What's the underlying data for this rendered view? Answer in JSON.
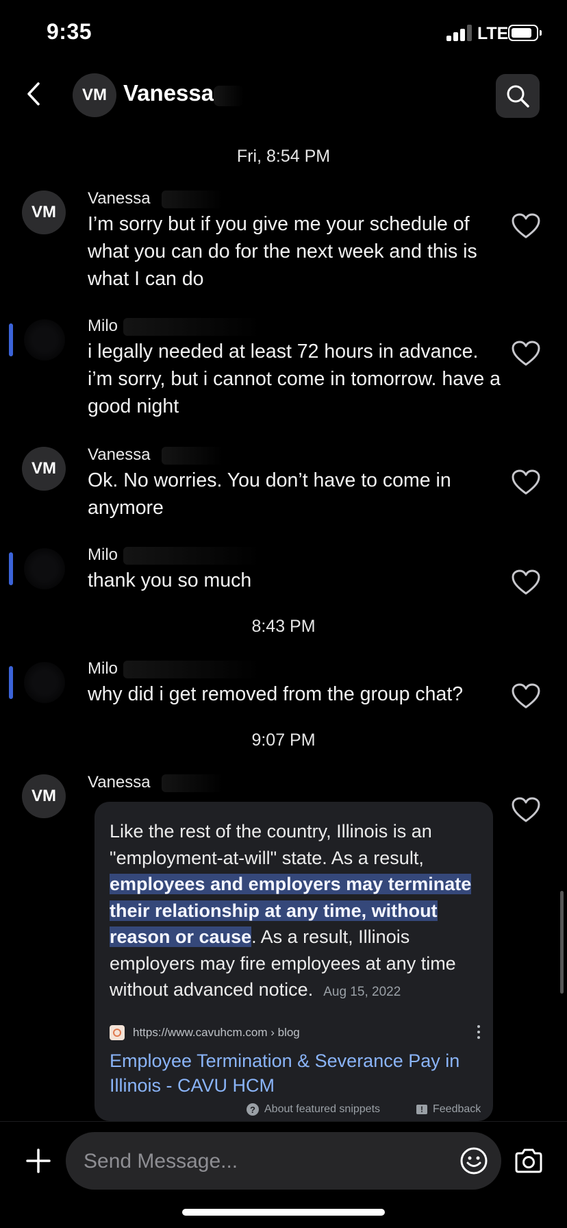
{
  "status_bar": {
    "time": "9:35",
    "network": "LTE"
  },
  "header": {
    "avatar_initials": "VM",
    "contact_name": "Vanessa"
  },
  "thread": {
    "timestamps": [
      "Fri, 8:54 PM",
      "8:43 PM",
      "9:07 PM"
    ],
    "messages": [
      {
        "sender": "Vanessa",
        "avatar": "VM",
        "text": "I’m sorry but if you give me your schedule of what you can do for the next week and this is what I can do"
      },
      {
        "sender": "Milo",
        "text": "i legally needed at least 72 hours in advance. i’m sorry, but i cannot come in tomorrow. have a good night"
      },
      {
        "sender": "Vanessa",
        "avatar": "VM",
        "text": "Ok. No worries. You don’t have to come in anymore"
      },
      {
        "sender": "Milo",
        "text": "thank you so much"
      },
      {
        "sender": "Milo",
        "text": "why did i get removed from the group chat?"
      },
      {
        "sender": "Vanessa",
        "avatar": "VM"
      }
    ]
  },
  "snippet": {
    "text_before": "Like the rest of the country, Illinois is an \"employment-at-will\" state. As a result, ",
    "highlight": "employees and employers may terminate their relationship at any time, without reason or cause",
    "text_after": ". As a result, Illinois employers may fire employees at any time without advanced notice.",
    "date": "Aug 15, 2022",
    "source_url": "https://www.cavuhcm.com › blog",
    "link_title": "Employee Termination & Severance Pay in Illinois - CAVU HCM",
    "about_label": "About featured snippets",
    "feedback_label": "Feedback"
  },
  "composer": {
    "placeholder": "Send Message..."
  },
  "colors": {
    "background": "#000000",
    "milo_indicator": "#3b63d8",
    "link": "#8ab4f8",
    "highlight": "#35487a"
  }
}
